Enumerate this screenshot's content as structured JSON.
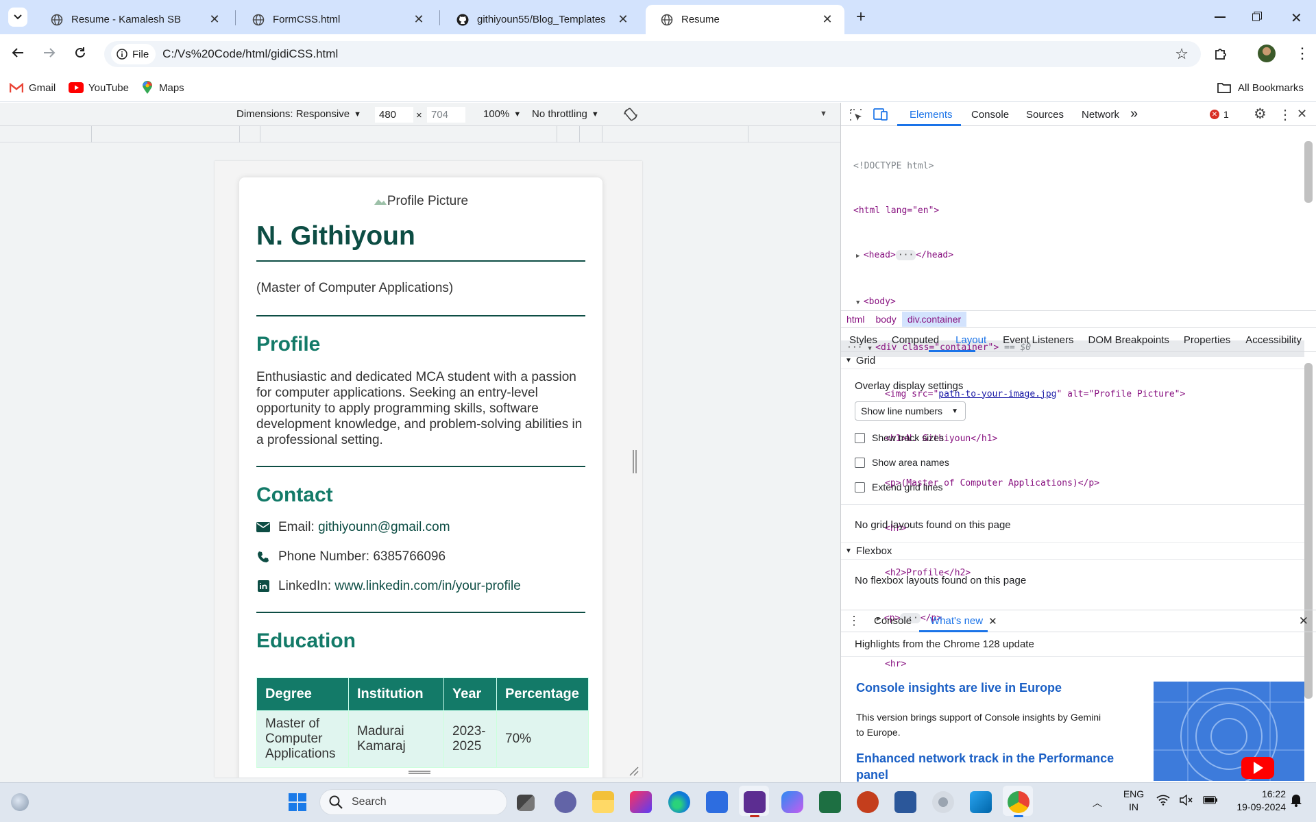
{
  "browser": {
    "tabs": [
      {
        "title": "Resume - Kamalesh SB",
        "icon": "globe-icon"
      },
      {
        "title": "FormCSS.html",
        "icon": "globe-icon"
      },
      {
        "title": "githiyoun55/Blog_Templates",
        "icon": "github-icon"
      },
      {
        "title": "Resume",
        "icon": "globe-icon"
      }
    ],
    "address": {
      "chip": "File",
      "url": "C:/Vs%20Code/html/gidiCSS.html"
    },
    "bookmarks": [
      {
        "label": "Gmail",
        "icon": "gmail-icon"
      },
      {
        "label": "YouTube",
        "icon": "youtube-icon"
      },
      {
        "label": "Maps",
        "icon": "maps-icon"
      }
    ],
    "all_bookmarks": "All Bookmarks"
  },
  "device_toolbar": {
    "dimensions": "Dimensions: Responsive",
    "width": "480",
    "times": "×",
    "height": "704",
    "zoom": "100%",
    "throttling": "No throttling"
  },
  "resume": {
    "img_alt": "Profile Picture",
    "name": "N. Githiyoun",
    "degree": "(Master of Computer Applications)",
    "profile_heading": "Profile",
    "profile_text": "Enthusiastic and dedicated MCA student with a passion for computer applications. Seeking an entry-level opportunity to apply programming skills, software development knowledge, and problem-solving abilities in a professional setting.",
    "contact_heading": "Contact",
    "email_label": "Email: ",
    "email": "githiyounn@gmail.com",
    "phone_label": "Phone Number: ",
    "phone": "6385766096",
    "linkedin_label": "LinkedIn: ",
    "linkedin": "www.linkedin.com/in/your-profile",
    "education_heading": "Education",
    "table_headers": [
      "Degree",
      "Institution",
      "Year",
      "Percentage"
    ],
    "table_row": [
      "Master of Computer Applications",
      "Madurai Kamaraj",
      "2023-2025",
      "70%"
    ]
  },
  "devtools": {
    "tabs": [
      "Elements",
      "Console",
      "Sources",
      "Network"
    ],
    "more": "»",
    "error_count": "1",
    "dom": [
      "<!DOCTYPE html>",
      "<html lang=\"en\">",
      "<head>",
      "</head>",
      "<body>",
      "<div class=\"container\">",
      "== $0",
      "<img src=\"",
      "path-to-your-image.jpg",
      "\" alt=\"Profile Picture\">",
      "<h1>N. Githiyoun</h1>",
      "<p>(Master of Computer Applications)</p>",
      "<hr>",
      "<h2>Profile</h2>",
      "<p>",
      "</p>",
      "<hr>"
    ],
    "breadcrumbs": [
      "html",
      "body",
      "div.container"
    ],
    "sub_tabs": [
      "Styles",
      "Computed",
      "Layout",
      "Event Listeners",
      "DOM Breakpoints",
      "Properties",
      "Accessibility"
    ],
    "grid_section": "Grid",
    "overlay_settings": "Overlay display settings",
    "line_numbers_select": "Show line numbers",
    "checkboxes": [
      "Show track sizes",
      "Show area names",
      "Extend grid lines"
    ],
    "no_grid": "No grid layouts found on this page",
    "flexbox_section": "Flexbox",
    "no_flex": "No flexbox layouts found on this page",
    "drawer_tabs": [
      "Console",
      "What's new"
    ],
    "highlights": "Highlights from the Chrome 128 update",
    "news": [
      {
        "title": "Console insights are live in Europe",
        "body": "This version brings support of Console insights by Gemini to Europe."
      },
      {
        "title": "Enhanced network track in the Performance panel",
        "body": ""
      }
    ]
  },
  "taskbar": {
    "search": "Search",
    "lang_top": "ENG",
    "lang_bottom": "IN",
    "time": "16:22",
    "date": "19-09-2024",
    "apps": [
      "task-view-icon",
      "teams-icon",
      "file-explorer-icon",
      "intellij-icon",
      "edge-icon",
      "store-icon",
      "vs-studio-icon",
      "copilot-icon",
      "excel-icon",
      "powerpoint-icon",
      "word-icon",
      "settings-icon",
      "vscode-icon",
      "chrome-icon"
    ]
  },
  "colors": {
    "accent": "#137a68",
    "dark": "#0d4d44",
    "chrome_blue": "#1a73e8"
  }
}
